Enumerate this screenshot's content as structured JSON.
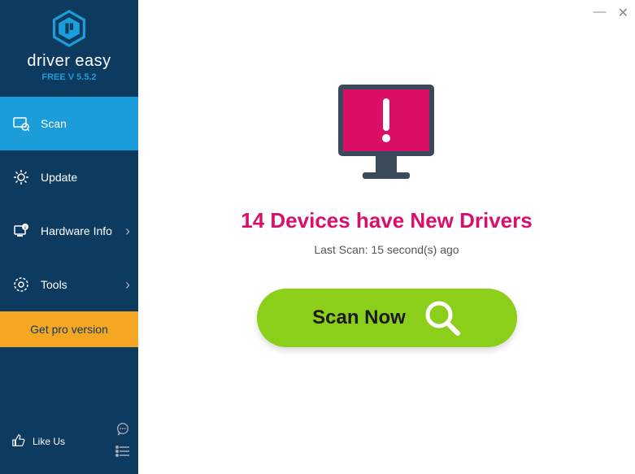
{
  "brand": {
    "name": "driver easy",
    "version_label": "FREE V 5.5.2"
  },
  "sidebar": {
    "items": [
      {
        "label": "Scan",
        "has_chevron": false
      },
      {
        "label": "Update",
        "has_chevron": false
      },
      {
        "label": "Hardware Info",
        "has_chevron": true
      },
      {
        "label": "Tools",
        "has_chevron": true
      }
    ],
    "pro_button": "Get pro version",
    "like_us": "Like Us"
  },
  "main": {
    "headline": "14 Devices have New Drivers",
    "subline": "Last Scan: 15 second(s) ago",
    "scan_button": "Scan Now"
  },
  "colors": {
    "sidebar_bg": "#0d3a5f",
    "active": "#1b9dd9",
    "pro": "#f5a623",
    "accent_pink": "#d9106b",
    "scan_green": "#8bcf1a"
  }
}
